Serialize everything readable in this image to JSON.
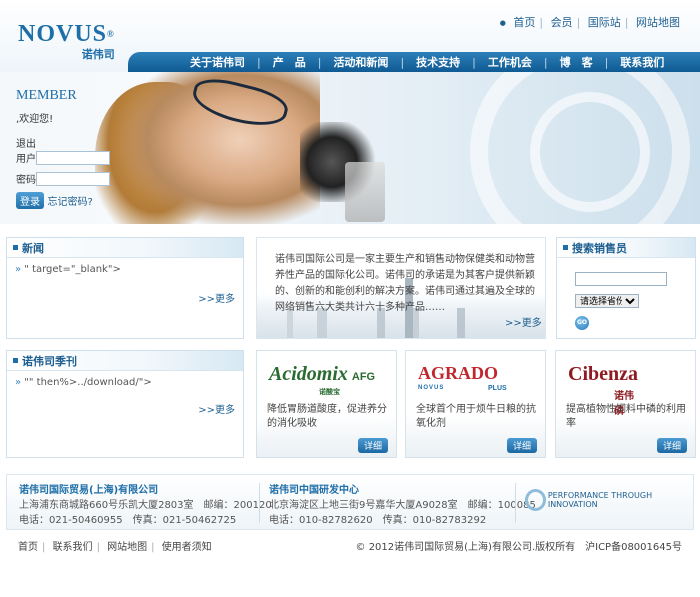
{
  "header": {
    "logo": {
      "brand": "NOVUS",
      "trademark": "®",
      "cn": "诺伟司"
    },
    "toplinks": [
      "首页",
      "会员",
      "国际站",
      "网站地图"
    ],
    "nav": [
      "关于诺伟司",
      "产　品",
      "活动和新闻",
      "技术支持",
      "工作机会",
      "博　客",
      "联系我们"
    ]
  },
  "member": {
    "title": "MEMBER",
    "welcome": ",欢迎您!",
    "logout": "退出",
    "user_label": "用户",
    "password_label": "密码",
    "login_button": "登录",
    "forgot": "忘记密码?"
  },
  "news": {
    "title": "新闻",
    "item": "\" target=\"_blank\">",
    "more": ">>更多"
  },
  "quarterly": {
    "title": "诺伟司季刊",
    "item": "\"\" then%>../download/\">",
    "more": ">>更多"
  },
  "intro": {
    "text": "诺伟司国际公司是一家主要生产和销售动物保健类和动物营养性产品的国际化公司。诺伟司的承诺是为其客户提供新颖的、创新的和能创利的解决方案。诺伟司通过其遍及全球的网络销售六大类共计六十多种产品……",
    "more": ">>更多"
  },
  "sales": {
    "title": "搜索销售员",
    "select_value": "请选择省份",
    "go": "GO"
  },
  "products": [
    {
      "brand": "Acidomix",
      "suffix": "AFG",
      "cn": "诺酸宝",
      "desc": "降低胃肠道酸度，促进养分的消化吸收",
      "detail": "详细"
    },
    {
      "brand": "AGRADO",
      "sub": "NOVUS",
      "plus": "PLUS",
      "desc": "全球首个用于烦牛日粮的抗氧化剂",
      "detail": "详细"
    },
    {
      "brand": "Cibenza",
      "cn": "诺伟磷",
      "desc": "提高植物性饲料中磷的利用率",
      "detail": "详细"
    }
  ],
  "footer": {
    "shanghai": {
      "title": "诺伟司国际贸易(上海)有限公司",
      "address": "上海浦东商城路660号乐凯大厦2803室　邮编：200120",
      "phone": "电话：021-50460955　传真：021-50462725"
    },
    "beijing": {
      "title": "诺伟司中国研发中心",
      "address": "北京海淀区上地三街9号嘉华大厦A9028室　邮编：100085",
      "phone": "电话：010-82782620　传真：010-82783292"
    },
    "slogan": "PERFORMANCE THROUGH INNOVATION",
    "links": [
      "首页",
      "联系我们",
      "网站地图",
      "使用者须知"
    ],
    "copyright": "© 2012诺伟司国际贸易(上海)有限公司.版权所有　沪ICP备08001645号"
  }
}
